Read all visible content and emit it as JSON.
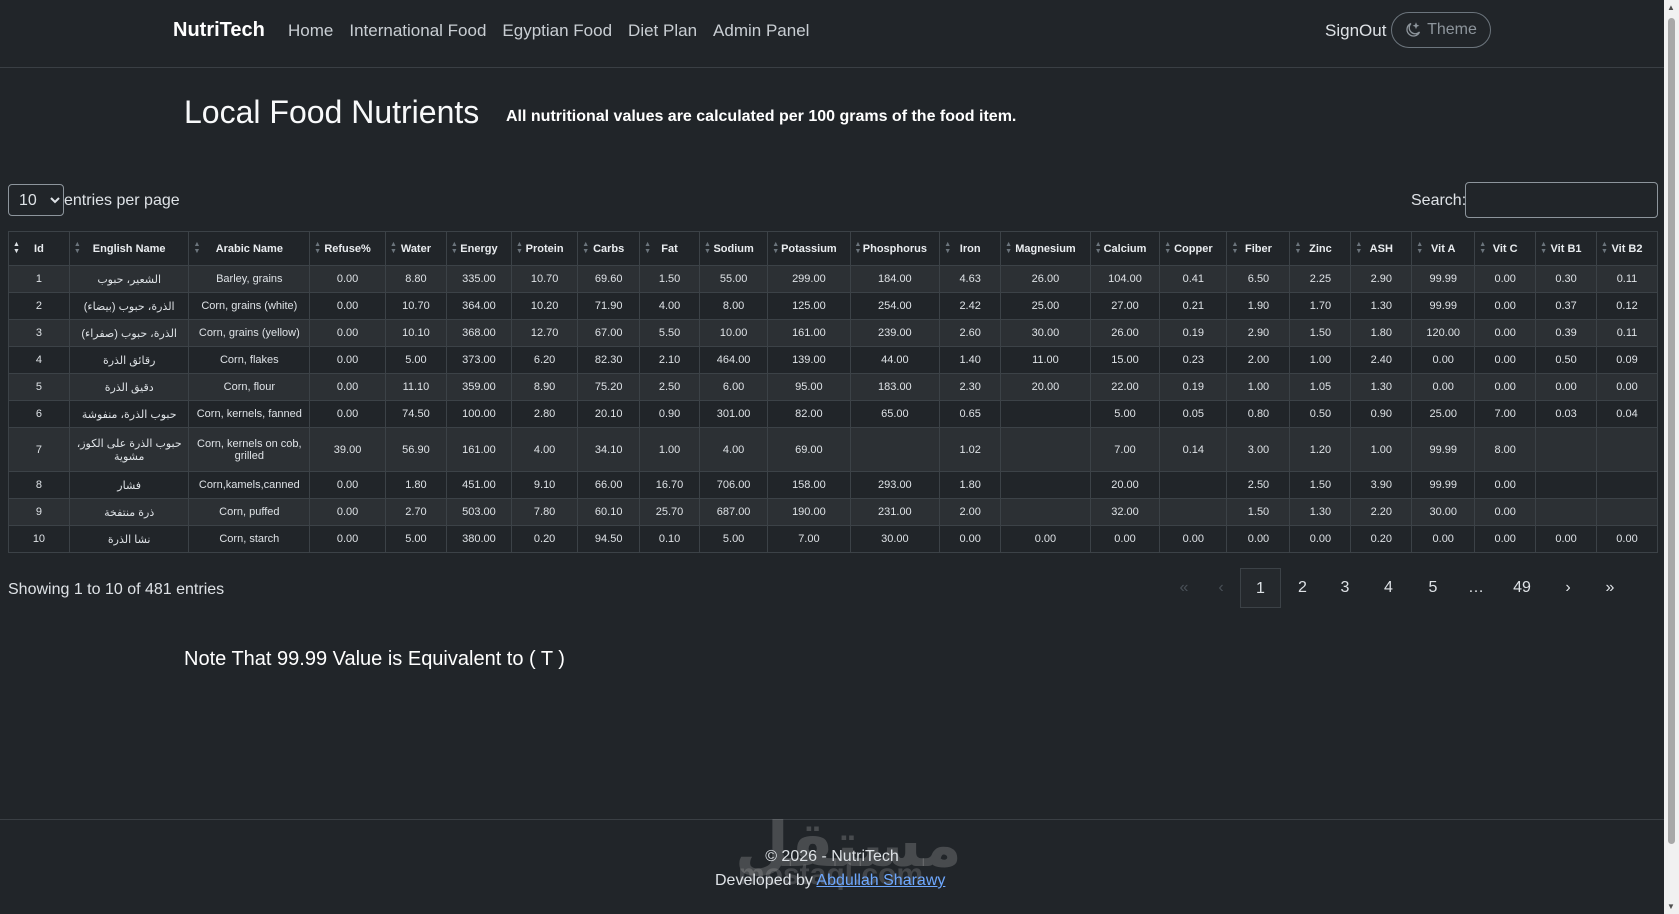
{
  "nav": {
    "brand": "NutriTech",
    "links": [
      "Home",
      "International Food",
      "Egyptian Food",
      "Diet Plan",
      "Admin Panel"
    ],
    "signout": "SignOut",
    "theme": "Theme"
  },
  "page": {
    "title": "Local Food Nutrients",
    "subtitle": "All nutritional values are calculated per 100 grams of the food item."
  },
  "controls": {
    "per_page_value": "10",
    "per_page_label": "entries per page",
    "search_label": "Search:"
  },
  "table": {
    "columns": [
      "Id",
      "English Name",
      "Arabic Name",
      "Refuse%",
      "Water",
      "Energy",
      "Protein",
      "Carbs",
      "Fat",
      "Sodium",
      "Potassium",
      "Phosphorus",
      "Iron",
      "Magnesium",
      "Calcium",
      "Copper",
      "Fiber",
      "Zinc",
      "ASH",
      "Vit A",
      "Vit C",
      "Vit B1",
      "Vit B2"
    ],
    "rows": [
      [
        "1",
        "الشعير، حبوب",
        "Barley, grains",
        "0.00",
        "8.80",
        "335.00",
        "10.70",
        "69.60",
        "1.50",
        "55.00",
        "299.00",
        "184.00",
        "4.63",
        "26.00",
        "104.00",
        "0.41",
        "6.50",
        "2.25",
        "2.90",
        "99.99",
        "0.00",
        "0.30",
        "0.11"
      ],
      [
        "2",
        "الذرة، حبوب (بيضاء)",
        "Corn, grains (white)",
        "0.00",
        "10.70",
        "364.00",
        "10.20",
        "71.90",
        "4.00",
        "8.00",
        "125.00",
        "254.00",
        "2.42",
        "25.00",
        "27.00",
        "0.21",
        "1.90",
        "1.70",
        "1.30",
        "99.99",
        "0.00",
        "0.37",
        "0.12"
      ],
      [
        "3",
        "الذرة، حبوب (صفراء)",
        "Corn, grains (yellow)",
        "0.00",
        "10.10",
        "368.00",
        "12.70",
        "67.00",
        "5.50",
        "10.00",
        "161.00",
        "239.00",
        "2.60",
        "30.00",
        "26.00",
        "0.19",
        "2.90",
        "1.50",
        "1.80",
        "120.00",
        "0.00",
        "0.39",
        "0.11"
      ],
      [
        "4",
        "رقائق الذرة",
        "Corn, flakes",
        "0.00",
        "5.00",
        "373.00",
        "6.20",
        "82.30",
        "2.10",
        "464.00",
        "139.00",
        "44.00",
        "1.40",
        "11.00",
        "15.00",
        "0.23",
        "2.00",
        "1.00",
        "2.40",
        "0.00",
        "0.00",
        "0.50",
        "0.09"
      ],
      [
        "5",
        "دقيق الذرة",
        "Corn, flour",
        "0.00",
        "11.10",
        "359.00",
        "8.90",
        "75.20",
        "2.50",
        "6.00",
        "95.00",
        "183.00",
        "2.30",
        "20.00",
        "22.00",
        "0.19",
        "1.00",
        "1.05",
        "1.30",
        "0.00",
        "0.00",
        "0.00",
        "0.00"
      ],
      [
        "6",
        "حبوب الذرة، منفوشة",
        "Corn, kernels, fanned",
        "0.00",
        "74.50",
        "100.00",
        "2.80",
        "20.10",
        "0.90",
        "301.00",
        "82.00",
        "65.00",
        "0.65",
        "",
        "5.00",
        "0.05",
        "0.80",
        "0.50",
        "0.90",
        "25.00",
        "7.00",
        "0.03",
        "0.04"
      ],
      [
        "7",
        "حبوب الذرة على الكوز، مشوية",
        "Corn, kernels on cob, grilled",
        "39.00",
        "56.90",
        "161.00",
        "4.00",
        "34.10",
        "1.00",
        "4.00",
        "69.00",
        "",
        "1.02",
        "",
        "7.00",
        "0.14",
        "3.00",
        "1.20",
        "1.00",
        "99.99",
        "8.00",
        "",
        ""
      ],
      [
        "8",
        "فشار",
        "Corn,kamels,canned",
        "0.00",
        "1.80",
        "451.00",
        "9.10",
        "66.00",
        "16.70",
        "706.00",
        "158.00",
        "293.00",
        "1.80",
        "",
        "20.00",
        "",
        "2.50",
        "1.50",
        "3.90",
        "99.99",
        "0.00",
        "",
        ""
      ],
      [
        "9",
        "ذرة منتفخة",
        "Corn, puffed",
        "0.00",
        "2.70",
        "503.00",
        "7.80",
        "60.10",
        "25.70",
        "687.00",
        "190.00",
        "231.00",
        "2.00",
        "",
        "32.00",
        "",
        "1.50",
        "1.30",
        "2.20",
        "30.00",
        "0.00",
        "",
        ""
      ],
      [
        "10",
        "نشا الذرة",
        "Corn, starch",
        "0.00",
        "5.00",
        "380.00",
        "0.20",
        "94.50",
        "0.10",
        "5.00",
        "7.00",
        "30.00",
        "0.00",
        "0.00",
        "0.00",
        "0.00",
        "0.00",
        "0.00",
        "0.20",
        "0.00",
        "0.00",
        "0.00",
        "0.00"
      ]
    ]
  },
  "info": "Showing 1 to 10 of 481 entries",
  "pagination": {
    "first": "«",
    "prev": "‹",
    "pages": [
      "1",
      "2",
      "3",
      "4",
      "5",
      "…",
      "49"
    ],
    "next": "›",
    "last": "»"
  },
  "note": "Note That 99.99 Value is Equivalent to ( T )",
  "footer": {
    "copyright": "© 2026 - NutriTech",
    "developed_by": "Developed by",
    "developer": "Abdullah Sharawy",
    "watermark": "مستقل",
    "watermark_sub": "mostaql.com"
  }
}
